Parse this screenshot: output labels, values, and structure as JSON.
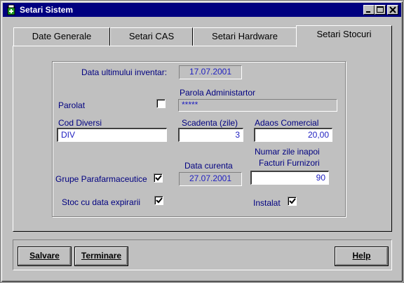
{
  "window": {
    "title": "Setari Sistem"
  },
  "tabs": [
    {
      "label": "Date Generale"
    },
    {
      "label": "Setari CAS"
    },
    {
      "label": "Setari Hardware"
    },
    {
      "label": "Setari Stocuri"
    }
  ],
  "form": {
    "data_ultimului_inventar": {
      "label": "Data ultimului inventar:",
      "value": "17.07.2001"
    },
    "parola_administrator": {
      "label": "Parola Administartor",
      "value": "*****"
    },
    "parolat": {
      "label": "Parolat",
      "checked": false
    },
    "cod_diversi": {
      "label": "Cod Diversi",
      "value": "DIV"
    },
    "scadenta": {
      "label": "Scadenta (zile)",
      "value": "3"
    },
    "adaos_comercial": {
      "label": "Adaos Comercial",
      "value": "20,00"
    },
    "grupe_parafarmaceutice": {
      "label": "Grupe Parafarmaceutice",
      "checked": true
    },
    "data_curenta": {
      "label": "Data curenta",
      "value": "27.07.2001"
    },
    "numar_zile": {
      "label_line1": "Numar zile inapoi",
      "label_line2": "Facturi Furnizori",
      "value": "90"
    },
    "stoc_data_expirarii": {
      "label": "Stoc cu data expirarii",
      "checked": true
    },
    "instalat": {
      "label": "Instalat",
      "checked": true
    }
  },
  "buttons": {
    "save": "Salvare",
    "close": "Terminare",
    "help": "Help"
  },
  "colors": {
    "titlebar": "#000080",
    "face": "#c0c0c0",
    "label_blue": "#000080",
    "value_blue": "#2020c0"
  }
}
